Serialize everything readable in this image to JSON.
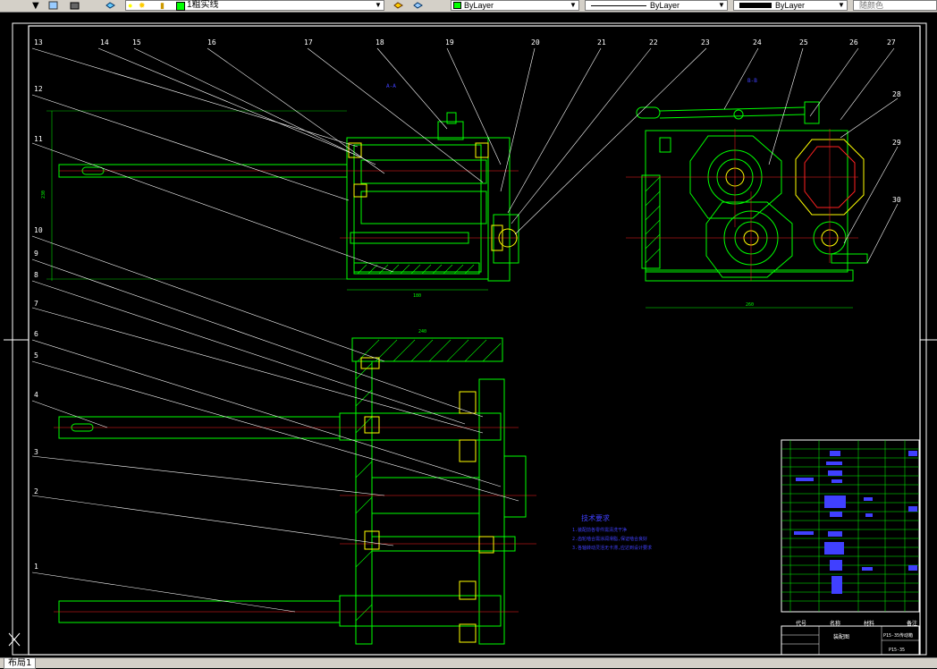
{
  "toolbar": {
    "layer_name": "1粗实线",
    "color_value": "ByLayer",
    "linetype_value": "ByLayer",
    "lineweight_value": "ByLayer",
    "plotstyle_value": "随颜色"
  },
  "drawing": {
    "top_view_label": "A-A",
    "right_view_label": "B-B",
    "dim_top_width": "180",
    "dim_top_height": "230",
    "dim_right_width": "260",
    "dim_bottom_width": "240",
    "callouts_left": [
      "13",
      "12",
      "11",
      "10",
      "9",
      "8",
      "7",
      "6",
      "5",
      "4",
      "3",
      "2",
      "1"
    ],
    "callouts_top": [
      "14",
      "15",
      "16",
      "17",
      "18",
      "19",
      "20",
      "21",
      "22",
      "23",
      "24",
      "25",
      "26",
      "27"
    ],
    "callouts_right": [
      "28",
      "29",
      "30"
    ],
    "tech_req_title": "技术要求",
    "tech_req_lines": [
      "1.装配前各零件需清洗干净",
      "2.齿轮啮合需涂润滑脂,保证啮合良好",
      "3.各轴转动灵活无卡滞,应达到设计要求"
    ],
    "title_block": {
      "col_code": "代号",
      "col_name": "名称",
      "col_material": "材料",
      "col_note": "备注",
      "drawing_name": "装配图",
      "model_no": "P15-35",
      "part_title": "P15-35传动箱"
    }
  },
  "status": {
    "layout_tab": "布局1"
  },
  "colors": {
    "green": "#00ff00",
    "red": "#ff2020",
    "white": "#ffffff",
    "blue": "#4040ff",
    "cyan": "#00ffff",
    "yellow": "#ffff00"
  }
}
